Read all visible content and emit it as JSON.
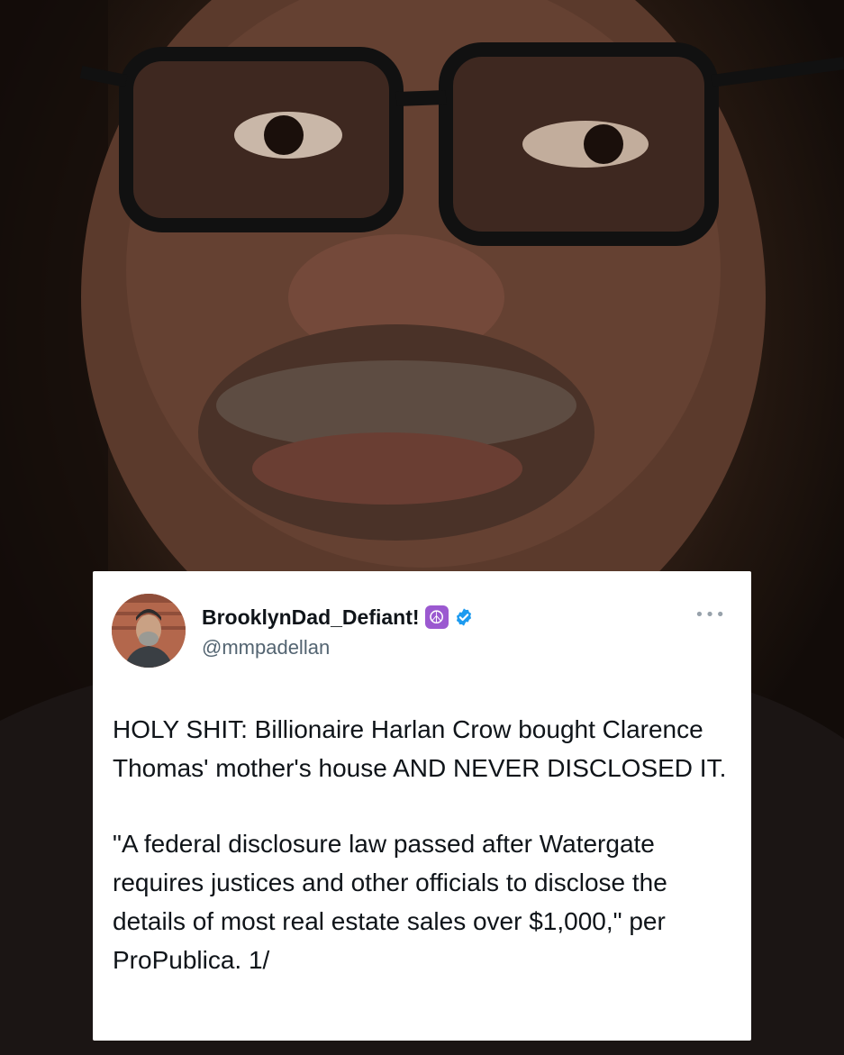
{
  "tweet": {
    "author_name": "BrooklynDad_Defiant!",
    "name_emoji": "☮",
    "handle": "@mmpadellan",
    "more_icon": "•••",
    "paragraph_1": "HOLY SHIT: Billionaire Harlan Crow bought Clarence Thomas' mother's house AND NEVER DISCLOSED IT.",
    "paragraph_2": "\"A federal disclosure law passed after Watergate requires justices and other officials to disclose the details of most real estate sales over $1,000,\" per ProPublica. 1/"
  },
  "colors": {
    "verified": "#1d9bf0",
    "peace_badge": "#9b59d0",
    "text": "#0f1419",
    "handle": "#536471"
  }
}
